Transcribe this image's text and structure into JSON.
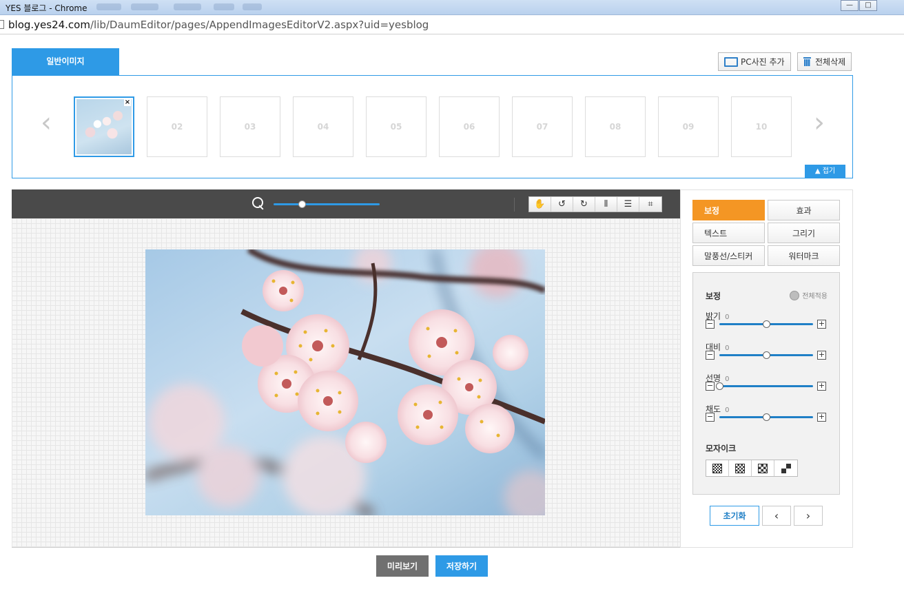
{
  "window": {
    "title": "YES 블로그 - Chrome",
    "url_host": "blog.yes24.com",
    "url_path": "/lib/DaumEditor/pages/AppendImagesEditorV2.aspx?uid=yesblog",
    "minimize_label": "—",
    "maximize_label": "□"
  },
  "header": {
    "tab_label": "일반이미지",
    "add_pc_photo_label": "PC사진 추가",
    "delete_all_label": "전체삭제"
  },
  "thumbnails": {
    "prev_arrow": "‹",
    "next_arrow": "›",
    "remove_label": "×",
    "slots": [
      "02",
      "03",
      "04",
      "05",
      "06",
      "07",
      "08",
      "09",
      "10"
    ],
    "fold_label": "▲ 접기"
  },
  "toolbar": {
    "zoom_level": 0.27,
    "tools": [
      {
        "name": "hand-icon",
        "glyph": "✋"
      },
      {
        "name": "rotate-left-icon",
        "glyph": "↺"
      },
      {
        "name": "rotate-right-icon",
        "glyph": "↻"
      },
      {
        "name": "flip-vertical-icon",
        "glyph": "⫴"
      },
      {
        "name": "flip-horizontal-icon",
        "glyph": "☰"
      },
      {
        "name": "crop-icon",
        "glyph": "⌗"
      }
    ]
  },
  "panel": {
    "tabs": {
      "correction": "보정",
      "effects": "효과",
      "text": "텍스트",
      "drawing": "그리기",
      "bubble_sticker": "말풍선/스티커",
      "watermark": "워터마크"
    },
    "section_title": "보정",
    "apply_all_label": "전체적용",
    "sliders": [
      {
        "label": "밝기",
        "value": "0",
        "position": 0.5
      },
      {
        "label": "대비",
        "value": "0",
        "position": 0.5
      },
      {
        "label": "선명",
        "value": "0",
        "position": 0.0
      },
      {
        "label": "채도",
        "value": "0",
        "position": 0.5
      }
    ],
    "minus_glyph": "−",
    "plus_glyph": "+",
    "mosaic_title": "모자이크",
    "reset_label": "초기화",
    "prev_label": "‹",
    "next_label": "›"
  },
  "footer": {
    "preview_label": "미리보기",
    "save_label": "저장하기"
  },
  "colors": {
    "accent_blue": "#2e9ae6",
    "active_orange": "#f49624",
    "preview_gray": "#707070"
  }
}
